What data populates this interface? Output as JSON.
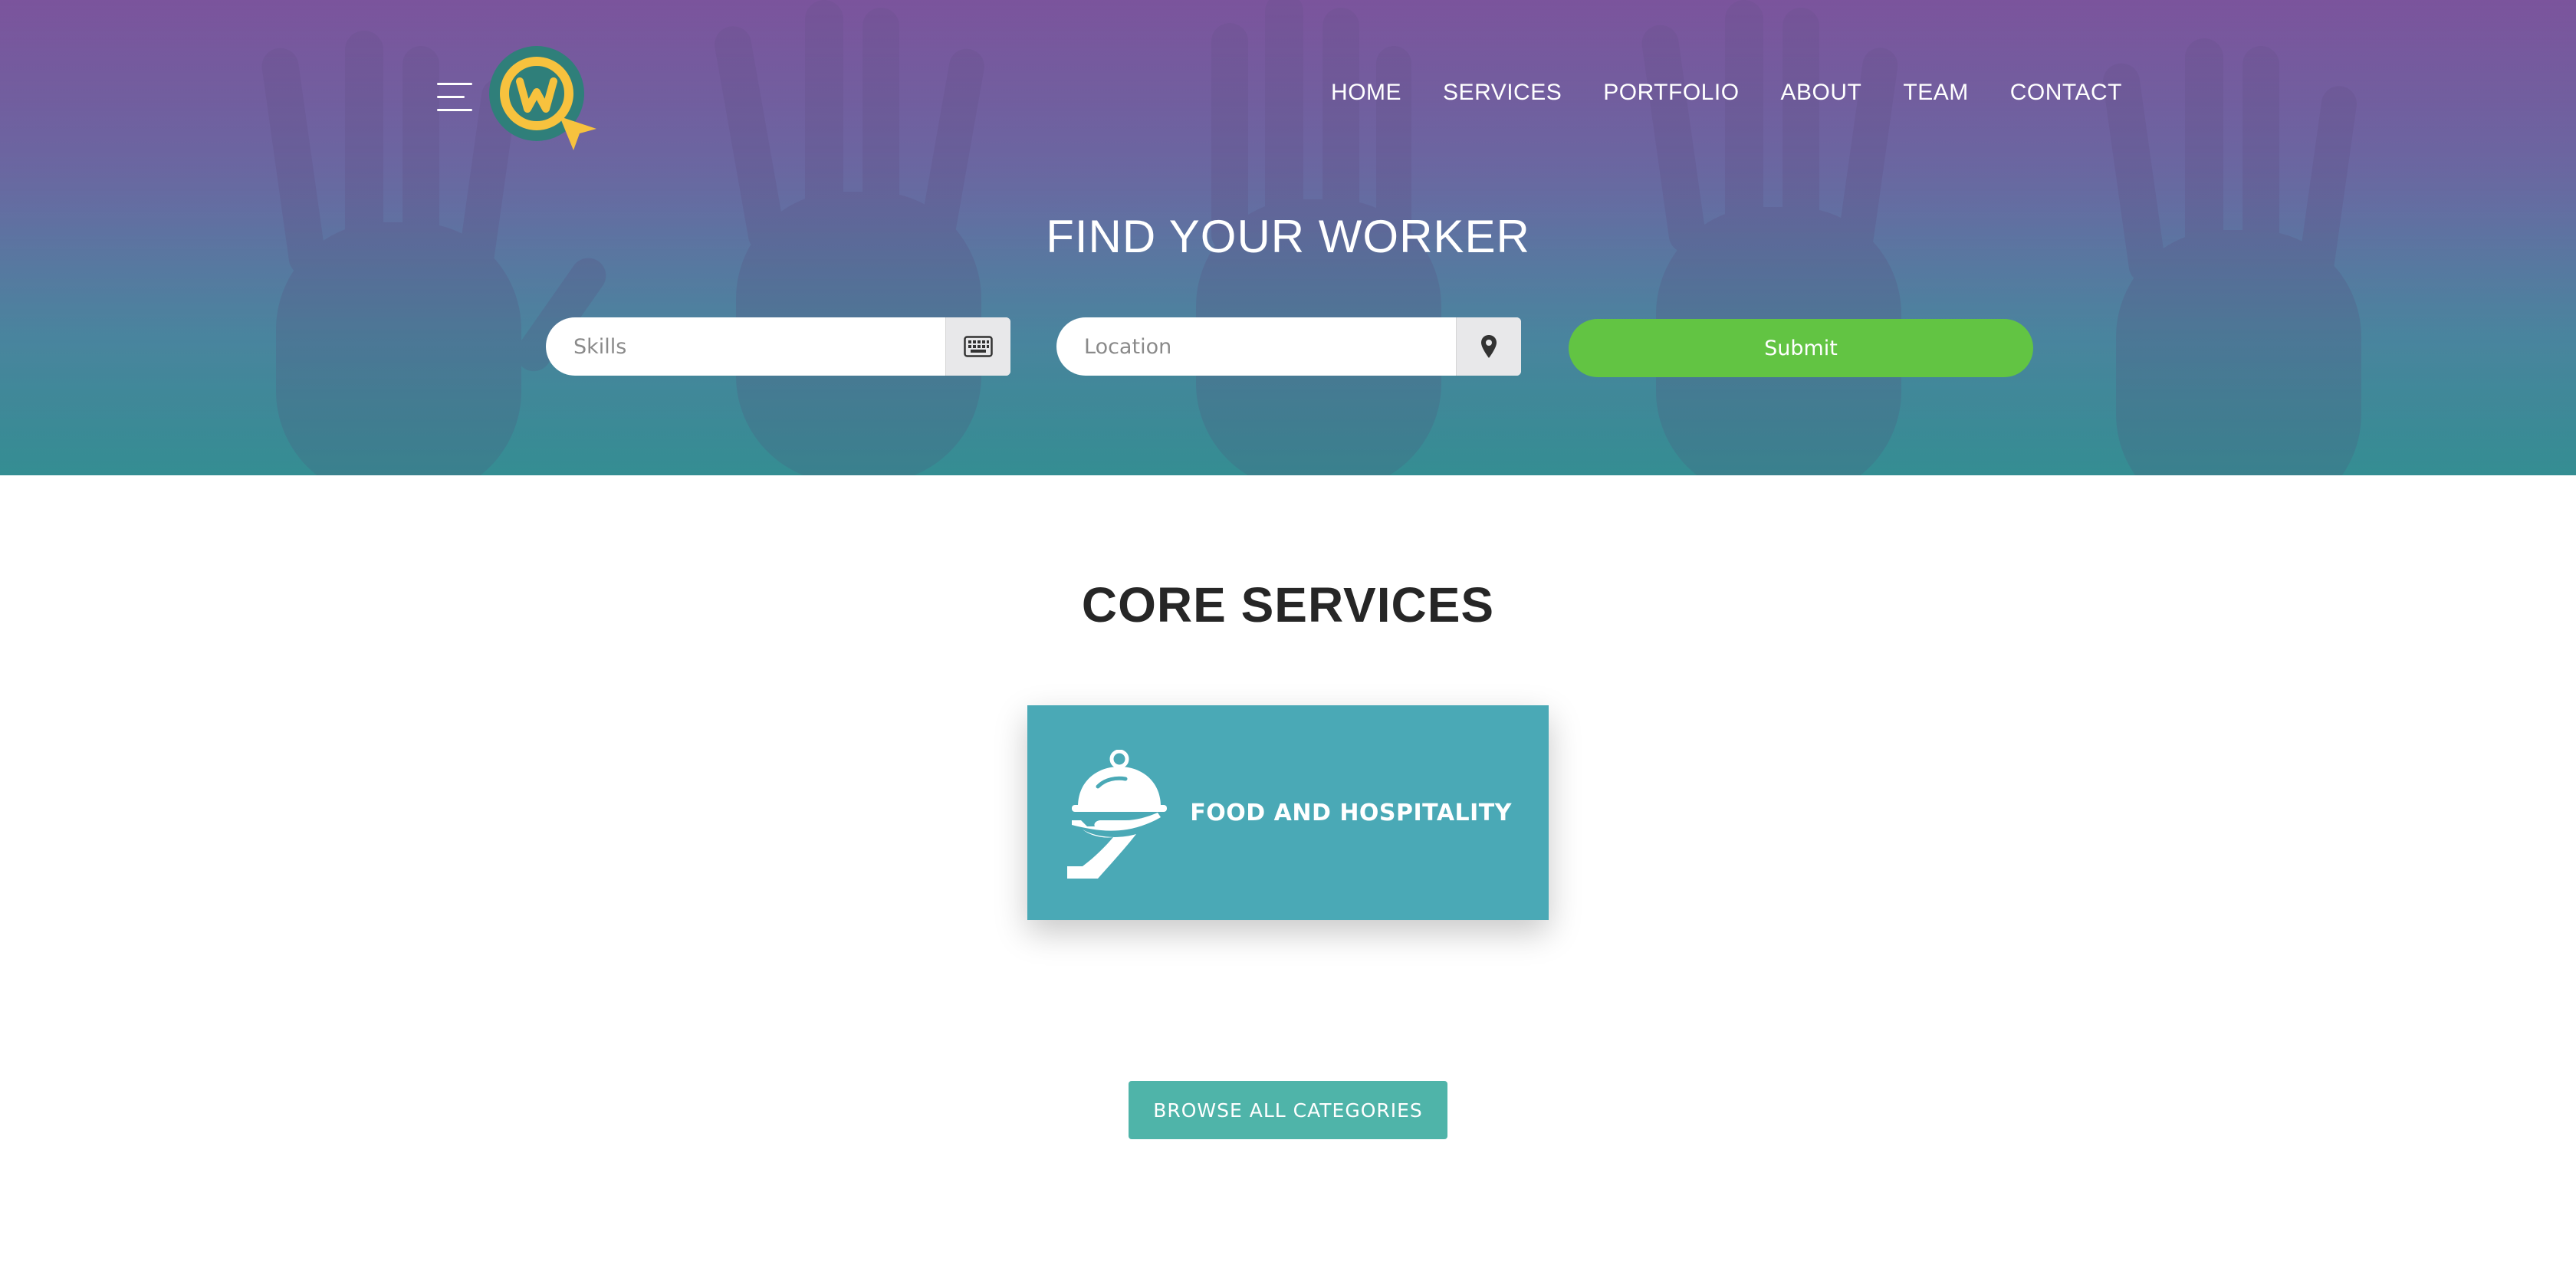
{
  "header": {
    "logo_icon": "worker-search-logo-icon",
    "menu_icon": "hamburger-menu-icon",
    "nav": [
      {
        "label": "HOME"
      },
      {
        "label": "SERVICES"
      },
      {
        "label": "PORTFOLIO"
      },
      {
        "label": "ABOUT"
      },
      {
        "label": "TEAM"
      },
      {
        "label": "CONTACT"
      }
    ]
  },
  "hero": {
    "title": "FIND YOUR WORKER",
    "skills_placeholder": "Skills",
    "skills_icon": "keyboard-icon",
    "location_placeholder": "Location",
    "location_icon": "map-pin-icon",
    "submit_label": "Submit"
  },
  "services": {
    "title": "CORE SERVICES",
    "cards": [
      {
        "label": "FOOD AND HOSPITALITY",
        "icon": "serving-cloche-icon"
      }
    ],
    "browse_label": "BROWSE ALL CATEGORIES"
  },
  "colors": {
    "accent_green": "#62c443",
    "card_teal": "#4aa9b6",
    "browse_teal": "#4fb4a9",
    "logo_teal": "#2f7f7a",
    "logo_yellow": "#f7c23e"
  }
}
